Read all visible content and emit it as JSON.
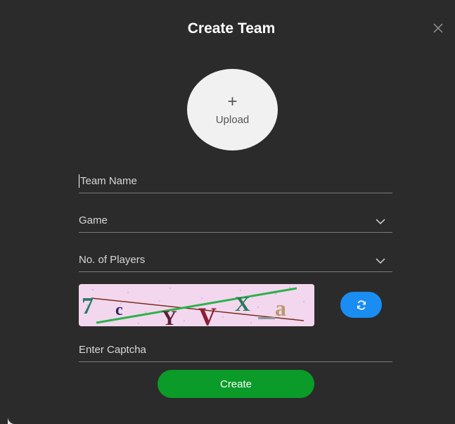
{
  "dialog": {
    "title": "Create Team",
    "close_icon": "close-icon"
  },
  "upload": {
    "plus": "+",
    "label": "Upload"
  },
  "fields": {
    "team_name": {
      "placeholder": "Team Name",
      "value": ""
    },
    "game": {
      "placeholder": "Game",
      "icon": "chevron-down-icon"
    },
    "players": {
      "placeholder": "No. of Players",
      "icon": "chevron-down-icon"
    },
    "captcha_input": {
      "placeholder": "Enter Captcha",
      "value": ""
    }
  },
  "captcha": {
    "chars": [
      "7",
      "c",
      "Y",
      "V",
      "X",
      "a"
    ],
    "refresh_icon": "refresh-icon"
  },
  "actions": {
    "create_label": "Create"
  },
  "colors": {
    "modal_bg": "#2b2b2b",
    "refresh": "#1a8df2",
    "create": "#0a9b28",
    "captcha_bg": "#f3d7ee"
  }
}
